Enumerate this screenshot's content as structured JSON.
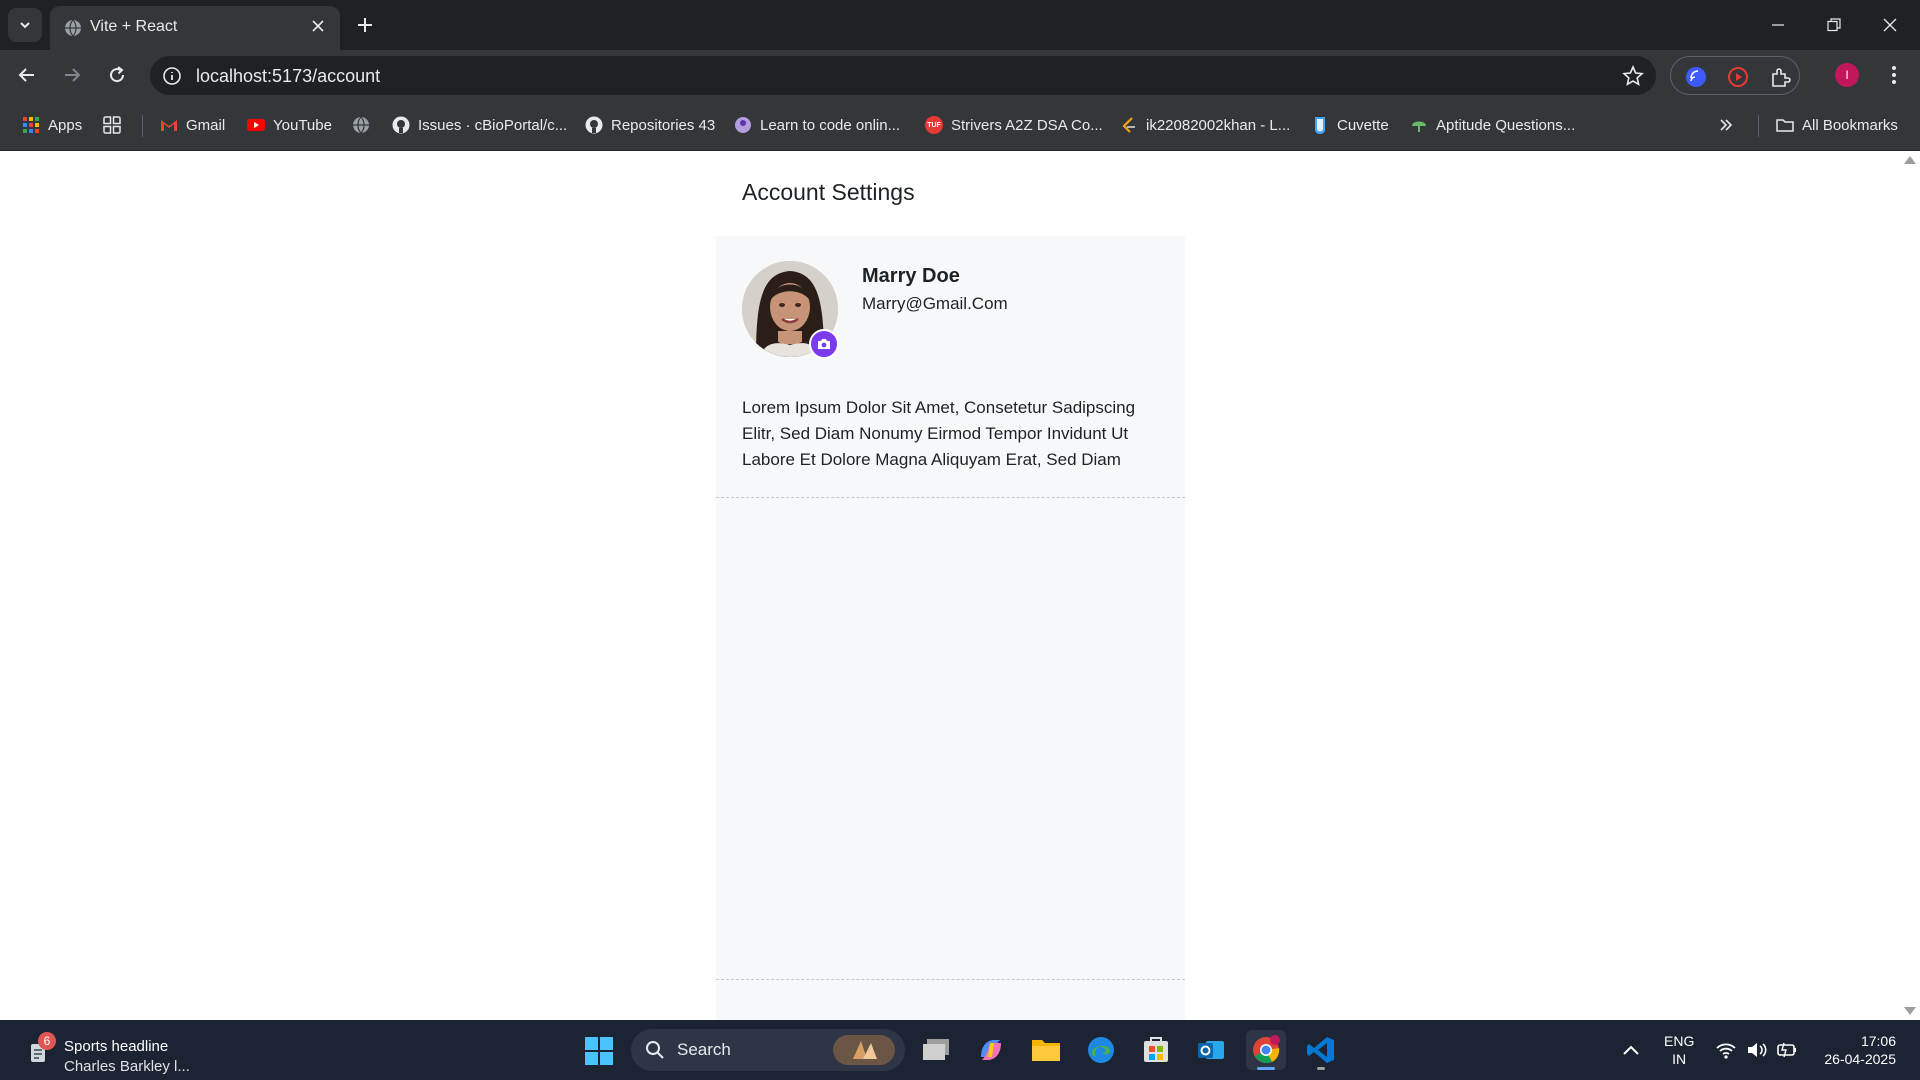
{
  "browser": {
    "tab_title": "Vite + React",
    "url": "localhost:5173/account",
    "bookmarks": [
      {
        "label": "Apps",
        "icon": "apps-grid-icon"
      },
      {
        "label": "Gmail",
        "icon": "gmail-icon"
      },
      {
        "label": "YouTube",
        "icon": "youtube-icon"
      },
      {
        "label": "Issues · cBioPortal/c...",
        "icon": "github-icon"
      },
      {
        "label": "Repositories 43",
        "icon": "github-icon"
      },
      {
        "label": "Learn to code onlin...",
        "icon": "learn-icon"
      },
      {
        "label": "Strivers A2Z DSA Co...",
        "icon": "tuf-icon"
      },
      {
        "label": "ik22082002khan - L...",
        "icon": "leetcode-icon"
      },
      {
        "label": "Cuvette",
        "icon": "cuvette-icon"
      },
      {
        "label": "Aptitude Questions...",
        "icon": "aptitude-icon"
      }
    ],
    "all_bookmarks_label": "All Bookmarks",
    "profile_initial": "I"
  },
  "page": {
    "title": "Account Settings",
    "user": {
      "name": "Marry Doe",
      "email": "Marry@Gmail.Com"
    },
    "bio": "Lorem Ipsum Dolor Sit Amet, Consetetur Sadipscing Elitr, Sed Diam Nonumy Eirmod Tempor Invidunt Ut Labore Et Dolore Magna Aliquyam Erat, Sed Diam"
  },
  "taskbar": {
    "news_badge": "6",
    "news_title": "Sports headline",
    "news_subtitle": "Charles Barkley l...",
    "search_label": "Search",
    "lang_line1": "ENG",
    "lang_line2": "IN",
    "time": "17:06",
    "date": "26-04-2025"
  },
  "colors": {
    "accent": "#7c3aed",
    "chrome_dark": "#202124",
    "chrome_mid": "#35363a",
    "panel_bg": "#f7f8fa",
    "taskbar_bg": "#1c2333"
  }
}
